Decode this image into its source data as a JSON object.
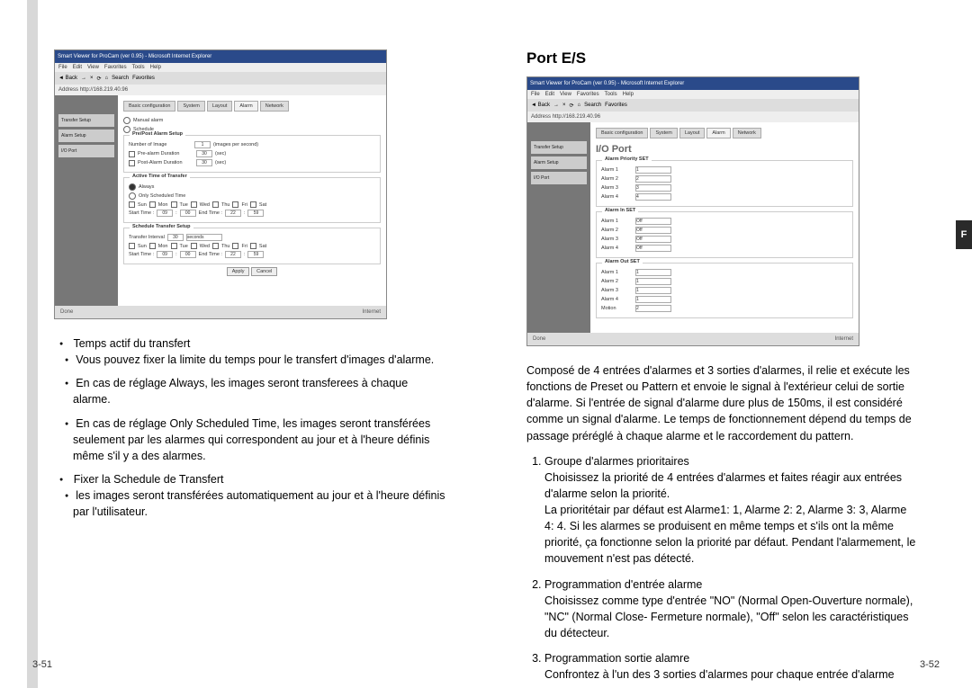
{
  "tab_letter": "F",
  "left": {
    "page_number": "3-51",
    "screenshot": {
      "title": "Smart Viewer for ProCam (ver 0.95) - Microsoft Internet Explorer",
      "menu": [
        "File",
        "Edit",
        "View",
        "Favorites",
        "Tools",
        "Help"
      ],
      "toolbar": [
        "Back",
        "→",
        "×",
        "⟳",
        "⌂",
        "Search",
        "Favorites",
        "⊕"
      ],
      "address_label": "Address",
      "address": "http://168.219.40.96",
      "tabs": [
        "Basic configuration",
        "System",
        "Layout",
        "Alarm",
        "Network"
      ],
      "nav": [
        "Transfer Setup",
        "Alarm Setup",
        "I/O Port"
      ],
      "mode_manual": "Manual alarm",
      "mode_schedule": "Schedule",
      "box1_title": "Pre/Post Alarm Setup",
      "box1": {
        "num_images_label": "Number of Image",
        "num_images_val": "1",
        "num_images_unit": "(images per second)",
        "pre_label": "Pre-alarm Duration",
        "pre_val": "30",
        "pre_unit": "(sec)",
        "post_label": "Post-Alarm Duration",
        "post_val": "30",
        "post_unit": "(sec)"
      },
      "box2_title": "Active Time of Transfer",
      "box2": {
        "opt_always": "Always",
        "opt_scheduled": "Only Scheduled Time",
        "days": [
          "Sun",
          "Mon",
          "Tue",
          "Wed",
          "Thu",
          "Fri",
          "Sat"
        ],
        "start_label": "Start Time :",
        "start_h": "09",
        "start_m": "00",
        "end_label": "End Time :",
        "end_h": "22",
        "end_m": "59"
      },
      "box3_title": "Schedule Transfer Setup",
      "box3": {
        "interval_label": "Transfer Interval",
        "interval_val": "30",
        "interval_unit": "seconds",
        "days": [
          "Sun",
          "Mon",
          "Tue",
          "Wed",
          "Thu",
          "Fri",
          "Sat"
        ],
        "start_label": "Start Time :",
        "start_h": "09",
        "start_m": "00",
        "end_label": "End Time :",
        "end_h": "22",
        "end_m": "59"
      },
      "apply": "Apply",
      "cancel": "Cancel",
      "status_left": "Done",
      "status_right": "Internet"
    },
    "bullet1": {
      "title": "Temps actif du transfert",
      "lines": [
        "Vous pouvez fixer la limite du temps pour le transfert d'images d'alarme.",
        "En cas de réglage Always, les images seront transferees à chaque alarme.",
        "En cas de réglage Only Scheduled Time, les images seront transférées seulement par les alarmes qui correspondent au jour et à l'heure définis même s'il y a des alarmes."
      ]
    },
    "bullet2": {
      "title": "Fixer la Schedule de Transfert",
      "lines": [
        "les images seront transférées automatiquement au jour et à l'heure définis par l'utilisateur."
      ]
    }
  },
  "right": {
    "page_number": "3-52",
    "heading": "Port E/S",
    "screenshot": {
      "title": "Smart Viewer for ProCam (ver 0.95) - Microsoft Internet Explorer",
      "menu": [
        "File",
        "Edit",
        "View",
        "Favorites",
        "Tools",
        "Help"
      ],
      "toolbar": [
        "Back",
        "→",
        "×",
        "⟳",
        "⌂",
        "Search",
        "Favorites",
        "⊕"
      ],
      "address_label": "Address",
      "address": "http://168.219.40.96",
      "tabs": [
        "Basic configuration",
        "System",
        "Layout",
        "Alarm",
        "Network"
      ],
      "nav": [
        "Transfer Setup",
        "Alarm Setup",
        "I/O Port"
      ],
      "page_title": "I/O Port",
      "box1_title": "Alarm Priority SET",
      "box1_rows": [
        {
          "label": "Alarm 1",
          "val": "1"
        },
        {
          "label": "Alarm 2",
          "val": "2"
        },
        {
          "label": "Alarm 3",
          "val": "3"
        },
        {
          "label": "Alarm 4",
          "val": "4"
        }
      ],
      "box2_title": "Alarm In SET",
      "box2_rows": [
        {
          "label": "Alarm 1",
          "val": "Off"
        },
        {
          "label": "Alarm 2",
          "val": "Off"
        },
        {
          "label": "Alarm 3",
          "val": "Off"
        },
        {
          "label": "Alarm 4",
          "val": "Off"
        }
      ],
      "box3_title": "Alarm Out SET",
      "box3_rows": [
        {
          "label": "Alarm 1",
          "val": "1"
        },
        {
          "label": "Alarm 2",
          "val": "1"
        },
        {
          "label": "Alarm 3",
          "val": "1"
        },
        {
          "label": "Alarm 4",
          "val": "1"
        },
        {
          "label": "Motion",
          "val": "2"
        }
      ],
      "status_left": "Done",
      "status_right": "Internet"
    },
    "intro": "Composé de 4 entrées d'alarmes et 3 sorties d'alarmes, il relie et exécute  les fonctions de Preset ou Pattern et envoie le signal à l'extérieur celui de sortie d'alarme. Si l'entrée de signal d'alarme dure plus de 150ms, il est considéré comme un signal d'alarme. Le temps de fonctionnement dépend du temps de passage préréglé à chaque alarme et le raccordement du pattern.",
    "item1": {
      "title": "Groupe d'alarmes prioritaires",
      "body": "Choisissez la priorité de 4 entrées d'alarmes et faites réagir aux entrées d'alarme selon la priorité.\nLa prioritétair par défaut est Alarme1: 1, Alarme 2: 2, Alarme 3: 3, Alarme 4: 4. Si les alarmes se produisent en même temps et s'ils ont la même priorité, ça fonctionne selon la priorité par défaut. Pendant l'alarmement, le mouvement n'est pas détecté."
    },
    "item2": {
      "title": "Programmation d'entrée alarme",
      "body": "Choisissez comme type d'entrée \"NO\" (Normal Open-Ouverture normale), \"NC\" (Normal Close- Fermeture normale), \"Off\" selon les caractéristiques du détecteur."
    },
    "item3": {
      "title": "Programmation sortie alamre",
      "body": "Confrontez à l'un des 3 sorties d'alarmes pour chaque entrée d'alarme"
    }
  }
}
